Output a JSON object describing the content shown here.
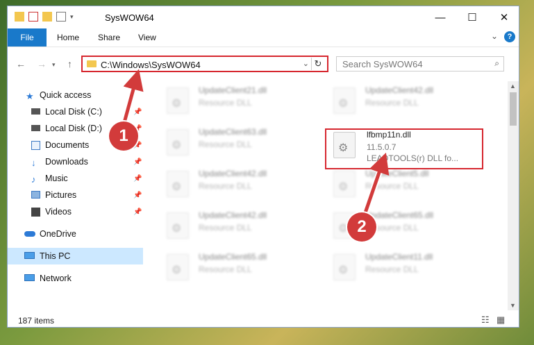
{
  "window": {
    "title": "SysWOW64"
  },
  "ribbon": {
    "tabs": [
      "File",
      "Home",
      "Share",
      "View"
    ],
    "help": "?"
  },
  "address": {
    "path": "C:\\Windows\\SysWOW64"
  },
  "search": {
    "placeholder": "Search SysWOW64"
  },
  "sidebar": {
    "items": [
      {
        "label": "Quick access",
        "icon": "star-icon"
      },
      {
        "label": "Local Disk (C:)",
        "icon": "drive-icon"
      },
      {
        "label": "Local Disk (D:)",
        "icon": "drive-icon"
      },
      {
        "label": "Documents",
        "icon": "documents-icon"
      },
      {
        "label": "Downloads",
        "icon": "download-icon"
      },
      {
        "label": "Music",
        "icon": "music-icon"
      },
      {
        "label": "Pictures",
        "icon": "pictures-icon"
      },
      {
        "label": "Videos",
        "icon": "videos-icon"
      },
      {
        "label": "OneDrive",
        "icon": "cloud-icon"
      },
      {
        "label": "This PC",
        "icon": "computer-icon"
      },
      {
        "label": "Network",
        "icon": "network-icon"
      }
    ]
  },
  "files": [
    {
      "name": "UpdateClient21.dll",
      "type": "Resource DLL"
    },
    {
      "name": "UpdateClient42.dll",
      "type": "Resource DLL"
    },
    {
      "name": "UpdateClient63.dll",
      "type": "Resource DLL"
    },
    {
      "name": "lfbmp11n.dll",
      "version": "11.5.0.7",
      "desc": "LEADTOOLS(r) DLL fo..."
    },
    {
      "name": "UpdateClient42.dll",
      "type": "Resource DLL"
    },
    {
      "name": "UpdateClient5.dll",
      "type": "Resource DLL"
    },
    {
      "name": "UpdateClient42.dll",
      "type": "Resource DLL"
    },
    {
      "name": "UpdateClient65.dll",
      "type": "Resource DLL"
    },
    {
      "name": "UpdateClient65.dll",
      "type": "Resource DLL"
    },
    {
      "name": "UpdateClient11.dll",
      "type": "Resource DLL"
    }
  ],
  "status": {
    "count": "187 items"
  },
  "markers": {
    "one": "1",
    "two": "2"
  },
  "colors": {
    "accent": "#1979ca",
    "highlight": "#d6262e",
    "marker": "#d23b3b",
    "selection": "#cce8ff"
  }
}
